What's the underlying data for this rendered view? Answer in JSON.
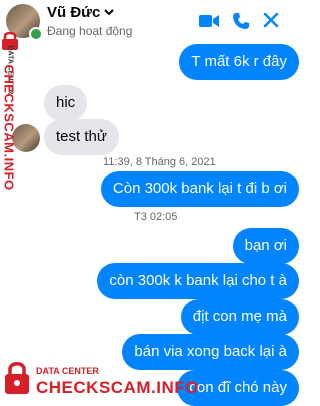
{
  "header": {
    "name": "Vũ Đức",
    "status": "Đang hoạt động",
    "accent": "#0084ff",
    "icons": [
      "video-call-icon",
      "phone-icon",
      "close-icon"
    ]
  },
  "messages": [
    {
      "type": "sent",
      "text": "T mất 6k r đây"
    },
    {
      "type": "recv",
      "text": "hic"
    },
    {
      "type": "recv",
      "text": "test thử"
    },
    {
      "type": "sent",
      "text": "Còn 300k bank lại t đi b ơi"
    },
    {
      "type": "sent",
      "text": "bạn ơi"
    },
    {
      "type": "sent",
      "text": "còn 300k k bank lại cho t à"
    },
    {
      "type": "sent",
      "text": "địt con mẹ mà"
    },
    {
      "type": "sent",
      "text": "bán via xong back lại à"
    },
    {
      "type": "sent",
      "text": "con đĩ chó này"
    }
  ],
  "timestamps": [
    "11:39, 8 Tháng 6, 2021",
    "T3 02:05"
  ],
  "watermark": {
    "line1": "DATA CENTER",
    "line2": "CHECKSCAM.INFO",
    "color": "#d61f26"
  }
}
